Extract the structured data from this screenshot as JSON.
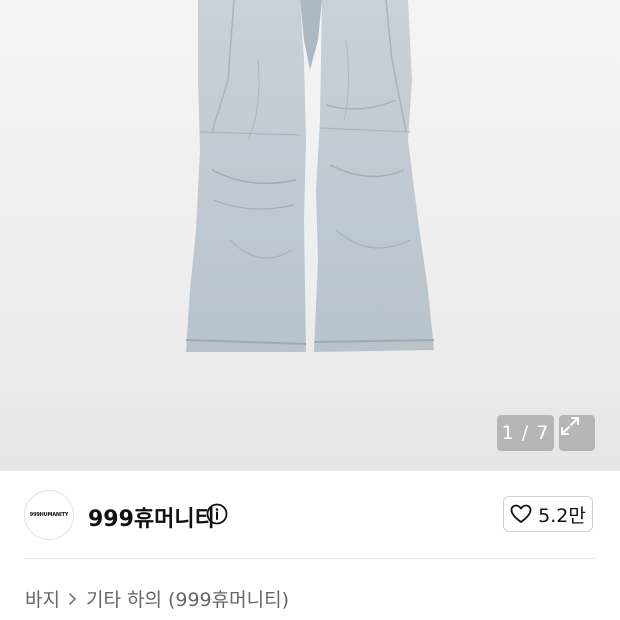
{
  "image_viewer": {
    "counter": "1 / 7"
  },
  "seller": {
    "avatar_text": "999HUMANITY",
    "name": "999휴머니티"
  },
  "like": {
    "count": "5.2만"
  },
  "breadcrumb": {
    "category": "바지",
    "subcategory": "기타 하의 (999휴머니티)"
  },
  "colors": {
    "hero_background": "#eeeeee",
    "pants": "#c6ced6",
    "overlay": "#8c8c8c"
  }
}
